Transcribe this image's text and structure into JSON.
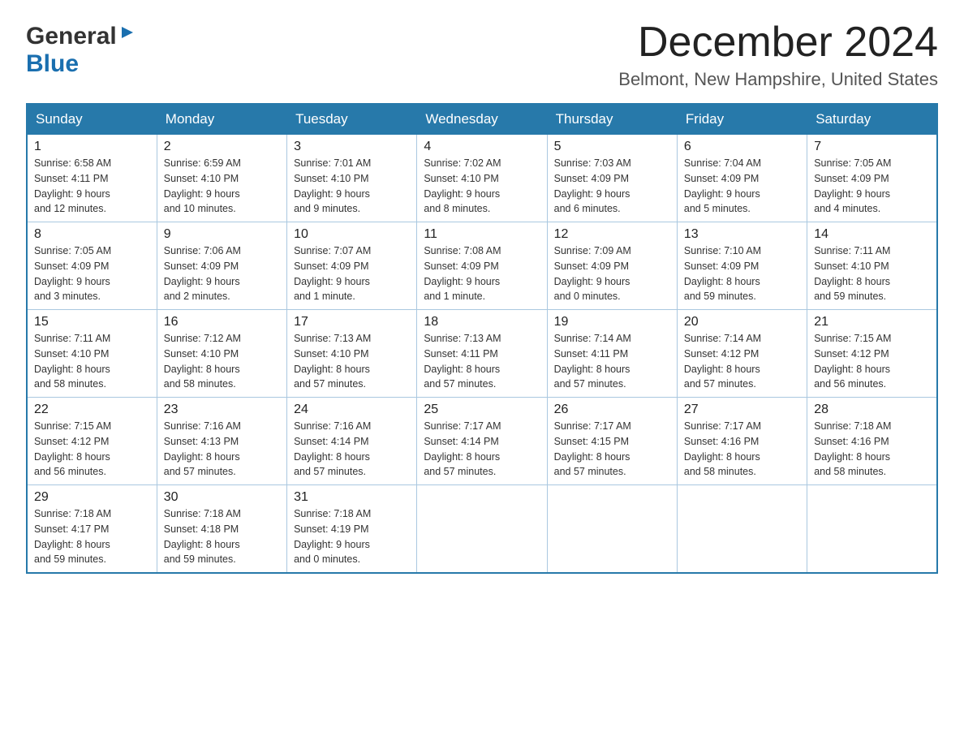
{
  "logo": {
    "general": "General",
    "blue": "Blue"
  },
  "header": {
    "title": "December 2024",
    "subtitle": "Belmont, New Hampshire, United States"
  },
  "weekdays": [
    "Sunday",
    "Monday",
    "Tuesday",
    "Wednesday",
    "Thursday",
    "Friday",
    "Saturday"
  ],
  "weeks": [
    [
      {
        "day": "1",
        "sunrise": "6:58 AM",
        "sunset": "4:11 PM",
        "daylight": "9 hours and 12 minutes."
      },
      {
        "day": "2",
        "sunrise": "6:59 AM",
        "sunset": "4:10 PM",
        "daylight": "9 hours and 10 minutes."
      },
      {
        "day": "3",
        "sunrise": "7:01 AM",
        "sunset": "4:10 PM",
        "daylight": "9 hours and 9 minutes."
      },
      {
        "day": "4",
        "sunrise": "7:02 AM",
        "sunset": "4:10 PM",
        "daylight": "9 hours and 8 minutes."
      },
      {
        "day": "5",
        "sunrise": "7:03 AM",
        "sunset": "4:09 PM",
        "daylight": "9 hours and 6 minutes."
      },
      {
        "day": "6",
        "sunrise": "7:04 AM",
        "sunset": "4:09 PM",
        "daylight": "9 hours and 5 minutes."
      },
      {
        "day": "7",
        "sunrise": "7:05 AM",
        "sunset": "4:09 PM",
        "daylight": "9 hours and 4 minutes."
      }
    ],
    [
      {
        "day": "8",
        "sunrise": "7:05 AM",
        "sunset": "4:09 PM",
        "daylight": "9 hours and 3 minutes."
      },
      {
        "day": "9",
        "sunrise": "7:06 AM",
        "sunset": "4:09 PM",
        "daylight": "9 hours and 2 minutes."
      },
      {
        "day": "10",
        "sunrise": "7:07 AM",
        "sunset": "4:09 PM",
        "daylight": "9 hours and 1 minute."
      },
      {
        "day": "11",
        "sunrise": "7:08 AM",
        "sunset": "4:09 PM",
        "daylight": "9 hours and 1 minute."
      },
      {
        "day": "12",
        "sunrise": "7:09 AM",
        "sunset": "4:09 PM",
        "daylight": "9 hours and 0 minutes."
      },
      {
        "day": "13",
        "sunrise": "7:10 AM",
        "sunset": "4:09 PM",
        "daylight": "8 hours and 59 minutes."
      },
      {
        "day": "14",
        "sunrise": "7:11 AM",
        "sunset": "4:10 PM",
        "daylight": "8 hours and 59 minutes."
      }
    ],
    [
      {
        "day": "15",
        "sunrise": "7:11 AM",
        "sunset": "4:10 PM",
        "daylight": "8 hours and 58 minutes."
      },
      {
        "day": "16",
        "sunrise": "7:12 AM",
        "sunset": "4:10 PM",
        "daylight": "8 hours and 58 minutes."
      },
      {
        "day": "17",
        "sunrise": "7:13 AM",
        "sunset": "4:10 PM",
        "daylight": "8 hours and 57 minutes."
      },
      {
        "day": "18",
        "sunrise": "7:13 AM",
        "sunset": "4:11 PM",
        "daylight": "8 hours and 57 minutes."
      },
      {
        "day": "19",
        "sunrise": "7:14 AM",
        "sunset": "4:11 PM",
        "daylight": "8 hours and 57 minutes."
      },
      {
        "day": "20",
        "sunrise": "7:14 AM",
        "sunset": "4:12 PM",
        "daylight": "8 hours and 57 minutes."
      },
      {
        "day": "21",
        "sunrise": "7:15 AM",
        "sunset": "4:12 PM",
        "daylight": "8 hours and 56 minutes."
      }
    ],
    [
      {
        "day": "22",
        "sunrise": "7:15 AM",
        "sunset": "4:12 PM",
        "daylight": "8 hours and 56 minutes."
      },
      {
        "day": "23",
        "sunrise": "7:16 AM",
        "sunset": "4:13 PM",
        "daylight": "8 hours and 57 minutes."
      },
      {
        "day": "24",
        "sunrise": "7:16 AM",
        "sunset": "4:14 PM",
        "daylight": "8 hours and 57 minutes."
      },
      {
        "day": "25",
        "sunrise": "7:17 AM",
        "sunset": "4:14 PM",
        "daylight": "8 hours and 57 minutes."
      },
      {
        "day": "26",
        "sunrise": "7:17 AM",
        "sunset": "4:15 PM",
        "daylight": "8 hours and 57 minutes."
      },
      {
        "day": "27",
        "sunrise": "7:17 AM",
        "sunset": "4:16 PM",
        "daylight": "8 hours and 58 minutes."
      },
      {
        "day": "28",
        "sunrise": "7:18 AM",
        "sunset": "4:16 PM",
        "daylight": "8 hours and 58 minutes."
      }
    ],
    [
      {
        "day": "29",
        "sunrise": "7:18 AM",
        "sunset": "4:17 PM",
        "daylight": "8 hours and 59 minutes."
      },
      {
        "day": "30",
        "sunrise": "7:18 AM",
        "sunset": "4:18 PM",
        "daylight": "8 hours and 59 minutes."
      },
      {
        "day": "31",
        "sunrise": "7:18 AM",
        "sunset": "4:19 PM",
        "daylight": "9 hours and 0 minutes."
      },
      null,
      null,
      null,
      null
    ]
  ],
  "labels": {
    "sunrise": "Sunrise:",
    "sunset": "Sunset:",
    "daylight": "Daylight:"
  },
  "colors": {
    "header_bg": "#2779aa",
    "border": "#aac8e0"
  }
}
